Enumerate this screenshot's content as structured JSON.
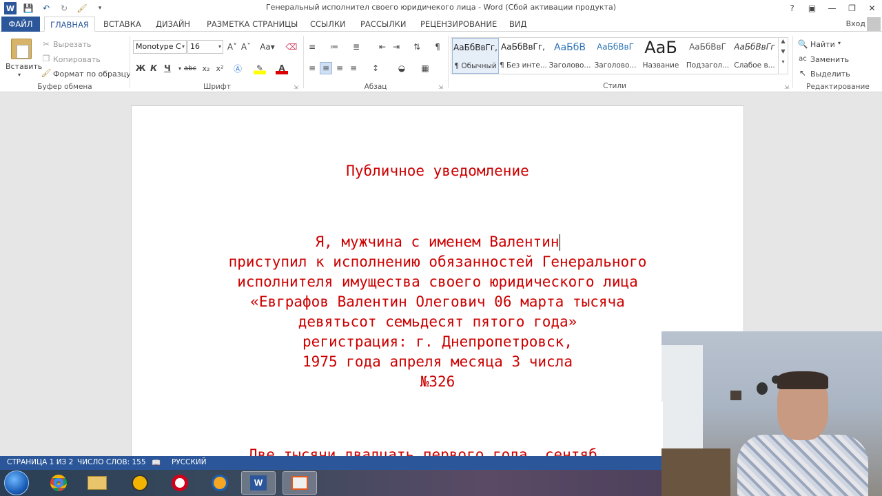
{
  "window": {
    "title": "Генеральный исполнител своего юридичекого лица - Word (Сбой активации продукта)",
    "signin": "Вход"
  },
  "tabs": {
    "file": "ФАЙЛ",
    "home": "ГЛАВНАЯ",
    "insert": "ВСТАВКА",
    "design": "ДИЗАЙН",
    "layout": "РАЗМЕТКА СТРАНИЦЫ",
    "references": "ССЫЛКИ",
    "mailings": "РАССЫЛКИ",
    "review": "РЕЦЕНЗИРОВАНИЕ",
    "view": "ВИД"
  },
  "ribbon": {
    "clipboard": {
      "paste": "Вставить",
      "cut": "Вырезать",
      "copy": "Копировать",
      "format_painter": "Формат по образцу",
      "label": "Буфер обмена"
    },
    "font": {
      "name": "Monotype C",
      "size": "16",
      "bold": "Ж",
      "italic": "К",
      "underline": "Ч",
      "strike": "abc",
      "subscript": "x₂",
      "superscript": "x²",
      "label": "Шрифт"
    },
    "paragraph": {
      "label": "Абзац"
    },
    "styles": {
      "label": "Стили",
      "items": [
        {
          "preview": "АаБбВвГг,",
          "name": "¶ Обычный"
        },
        {
          "preview": "АаБбВвГг,",
          "name": "¶ Без инте..."
        },
        {
          "preview": "АаБбВ",
          "name": "Заголово..."
        },
        {
          "preview": "АаБбВвГ",
          "name": "Заголово..."
        },
        {
          "preview": "АаБ",
          "name": "Название"
        },
        {
          "preview": "АаБбВвГ",
          "name": "Подзагол..."
        },
        {
          "preview": "АаБбВвГг",
          "name": "Слабое в..."
        }
      ]
    },
    "editing": {
      "find": "Найти",
      "replace": "Заменить",
      "select": "Выделить",
      "label": "Редактирование"
    }
  },
  "document": {
    "lines": [
      "Публичное уведомление",
      "Я, мужчина с именем Валентин",
      "приступил к исполнению обязанностей Генерального",
      "исполнителя имущества своего юридического лица",
      "«Евграфов Валентин Олегович 06 марта тысяча",
      "девятьсот семьдесят пятого года»",
      "регистрация: г. Днепропетровск,",
      "1975 года апреля месяца 3 числа",
      "№326",
      "Две тысячи двадцать первого года, сентяб"
    ]
  },
  "status": {
    "page": "СТРАНИЦА 1 ИЗ 2",
    "words": "ЧИСЛО СЛОВ: 155",
    "language": "РУССКИЙ"
  },
  "colors": {
    "accent": "#2b579a",
    "doc_text": "#cc0000"
  }
}
